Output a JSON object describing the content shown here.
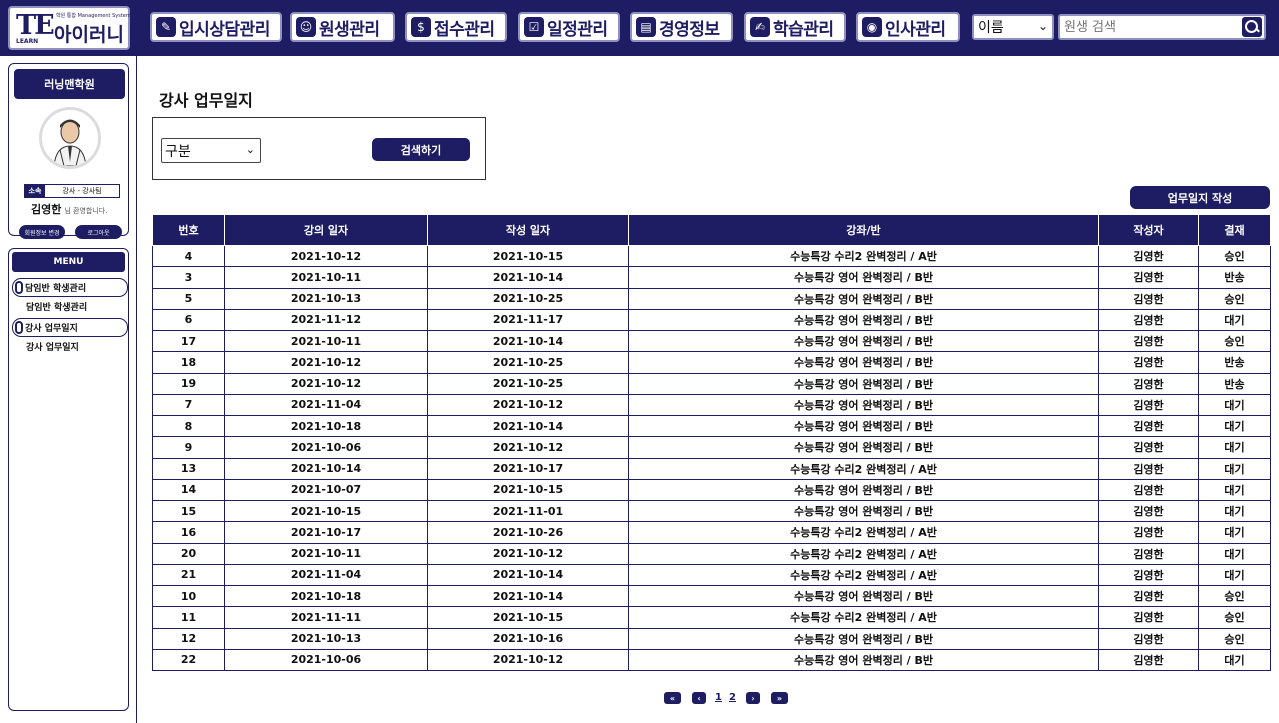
{
  "header": {
    "logo": {
      "mark": "TE",
      "learn": "LEARN",
      "subtitle": "학원 통합 Management System",
      "name": "아이러니"
    },
    "nav": [
      {
        "label": "입시상담관리",
        "icon": "pencil-icon"
      },
      {
        "label": "원생관리",
        "icon": "users-icon"
      },
      {
        "label": "접수관리",
        "icon": "dollar-icon"
      },
      {
        "label": "일정관리",
        "icon": "checkbox-icon"
      },
      {
        "label": "경영정보",
        "icon": "document-icon"
      },
      {
        "label": "학습관리",
        "icon": "edit-icon"
      },
      {
        "label": "인사관리",
        "icon": "eye-slash-icon"
      }
    ],
    "search": {
      "field_value": "이름",
      "placeholder": "원생 검색"
    }
  },
  "sidebar": {
    "academy": "러닝맨학원",
    "affiliation_label": "소속",
    "affiliation_value": "강사 - 강사팀",
    "user_name": "김영한",
    "greeting": "님 환영합니다.",
    "btn_edit": "회원정보 변경",
    "btn_logout": "로그아웃",
    "menu_title": "MENU",
    "groups": [
      {
        "title": "담임반 학생관리",
        "items": [
          "담임반 학생관리"
        ]
      },
      {
        "title": "강사 업무일지",
        "items": [
          "강사 업무일지"
        ]
      }
    ]
  },
  "main": {
    "title": "강사 업무일지",
    "filter": {
      "select_value": "구분",
      "search_label": "검색하기"
    },
    "write_label": "업무일지 작성",
    "columns": [
      "번호",
      "강의 일자",
      "작성 일자",
      "강좌/반",
      "작성자",
      "결재"
    ],
    "rows": [
      [
        "4",
        "2021-10-12",
        "2021-10-15",
        "수능특강 수리2 완벽정리 / A반",
        "김영한",
        "승인"
      ],
      [
        "3",
        "2021-10-11",
        "2021-10-14",
        "수능특강 영어 완벽정리 / B반",
        "김영한",
        "반송"
      ],
      [
        "5",
        "2021-10-13",
        "2021-10-25",
        "수능특강 영어 완벽정리 / B반",
        "김영한",
        "승인"
      ],
      [
        "6",
        "2021-11-12",
        "2021-11-17",
        "수능특강 영어 완벽정리 / B반",
        "김영한",
        "대기"
      ],
      [
        "17",
        "2021-10-11",
        "2021-10-14",
        "수능특강 영어 완벽정리 / B반",
        "김영한",
        "승인"
      ],
      [
        "18",
        "2021-10-12",
        "2021-10-25",
        "수능특강 영어 완벽정리 / B반",
        "김영한",
        "반송"
      ],
      [
        "19",
        "2021-10-12",
        "2021-10-25",
        "수능특강 영어 완벽정리 / B반",
        "김영한",
        "반송"
      ],
      [
        "7",
        "2021-11-04",
        "2021-10-12",
        "수능특강 영어 완벽정리 / B반",
        "김영한",
        "대기"
      ],
      [
        "8",
        "2021-10-18",
        "2021-10-14",
        "수능특강 영어 완벽정리 / B반",
        "김영한",
        "대기"
      ],
      [
        "9",
        "2021-10-06",
        "2021-10-12",
        "수능특강 영어 완벽정리 / B반",
        "김영한",
        "대기"
      ],
      [
        "13",
        "2021-10-14",
        "2021-10-17",
        "수능특강 수리2 완벽정리 / A반",
        "김영한",
        "대기"
      ],
      [
        "14",
        "2021-10-07",
        "2021-10-15",
        "수능특강 영어 완벽정리 / B반",
        "김영한",
        "대기"
      ],
      [
        "15",
        "2021-10-15",
        "2021-11-01",
        "수능특강 영어 완벽정리 / B반",
        "김영한",
        "대기"
      ],
      [
        "16",
        "2021-10-17",
        "2021-10-26",
        "수능특강 수리2 완벽정리 / A반",
        "김영한",
        "대기"
      ],
      [
        "20",
        "2021-10-11",
        "2021-10-12",
        "수능특강 수리2 완벽정리 / A반",
        "김영한",
        "대기"
      ],
      [
        "21",
        "2021-11-04",
        "2021-10-14",
        "수능특강 수리2 완벽정리 / A반",
        "김영한",
        "대기"
      ],
      [
        "10",
        "2021-10-18",
        "2021-10-14",
        "수능특강 영어 완벽정리 / B반",
        "김영한",
        "승인"
      ],
      [
        "11",
        "2021-11-11",
        "2021-10-15",
        "수능특강 수리2 완벽정리 / A반",
        "김영한",
        "승인"
      ],
      [
        "12",
        "2021-10-13",
        "2021-10-16",
        "수능특강 영어 완벽정리 / B반",
        "김영한",
        "승인"
      ],
      [
        "22",
        "2021-10-06",
        "2021-10-12",
        "수능특강 영어 완벽정리 / B반",
        "김영한",
        "대기"
      ]
    ],
    "pagination": {
      "first": "«",
      "prev": "‹",
      "pages": [
        "1",
        "2"
      ],
      "next": "›",
      "last": "»"
    }
  },
  "colors": {
    "brand": "#1e1d63",
    "border_light": "#8f8fc0"
  }
}
